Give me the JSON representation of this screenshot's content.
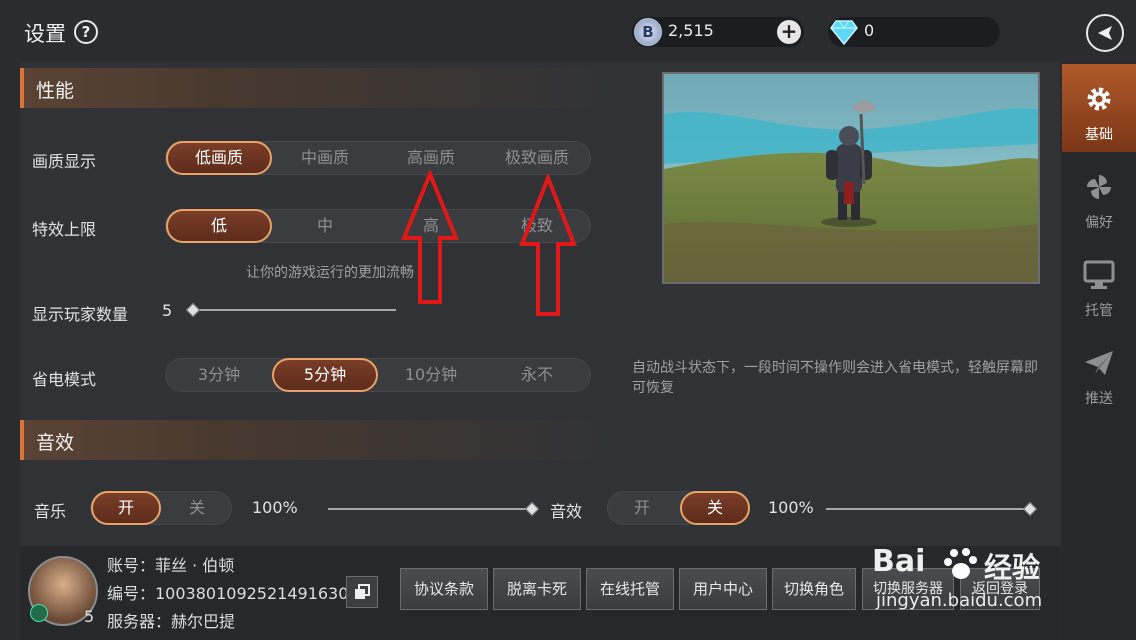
{
  "header": {
    "title": "设置",
    "help": "?",
    "currency_b": {
      "icon": "b-coin-icon",
      "value": "2,515"
    },
    "gems": {
      "icon": "diamond-icon",
      "value": "0"
    }
  },
  "sections": {
    "performance": "性能",
    "sound": "音效"
  },
  "quality": {
    "label": "画质显示",
    "options": [
      "低画质",
      "中画质",
      "高画质",
      "极致画质"
    ],
    "selected": 0
  },
  "effects": {
    "label": "特效上限",
    "options": [
      "低",
      "中",
      "高",
      "极致"
    ],
    "selected": 0,
    "hint": "让你的游戏运行的更加流畅"
  },
  "players": {
    "label": "显示玩家数量",
    "value": "5"
  },
  "power": {
    "label": "省电模式",
    "options": [
      "3分钟",
      "5分钟",
      "10分钟",
      "永不"
    ],
    "selected": 1,
    "hint": "自动战斗状态下，一段时间不操作则会进入省电模式，轻触屏幕即可恢复"
  },
  "music": {
    "label": "音乐",
    "on": "开",
    "off": "关",
    "selected": "on",
    "volume": "100%"
  },
  "sfx": {
    "label": "音效",
    "on": "开",
    "off": "关",
    "selected": "off",
    "volume": "100%"
  },
  "sidebar": {
    "items": [
      {
        "label": "基础",
        "icon": "gear-icon",
        "active": true
      },
      {
        "label": "偏好",
        "icon": "pinwheel-icon",
        "active": false
      },
      {
        "label": "托管",
        "icon": "monitor-icon",
        "active": false
      },
      {
        "label": "推送",
        "icon": "paper-plane-icon",
        "active": false
      }
    ]
  },
  "account": {
    "name": "账号：菲丝 · 伯顿",
    "id": "编号：1003801092521491630",
    "server": "服务器：赫尔巴提",
    "level": "5"
  },
  "buttons": [
    "协议条款",
    "脱离卡死",
    "在线托管",
    "用户中心",
    "切换角色",
    "切换服务器",
    "返回登录"
  ],
  "watermark": {
    "brand": "Bai",
    "brand2": "经验",
    "url": "jingyan.baidu.com"
  }
}
